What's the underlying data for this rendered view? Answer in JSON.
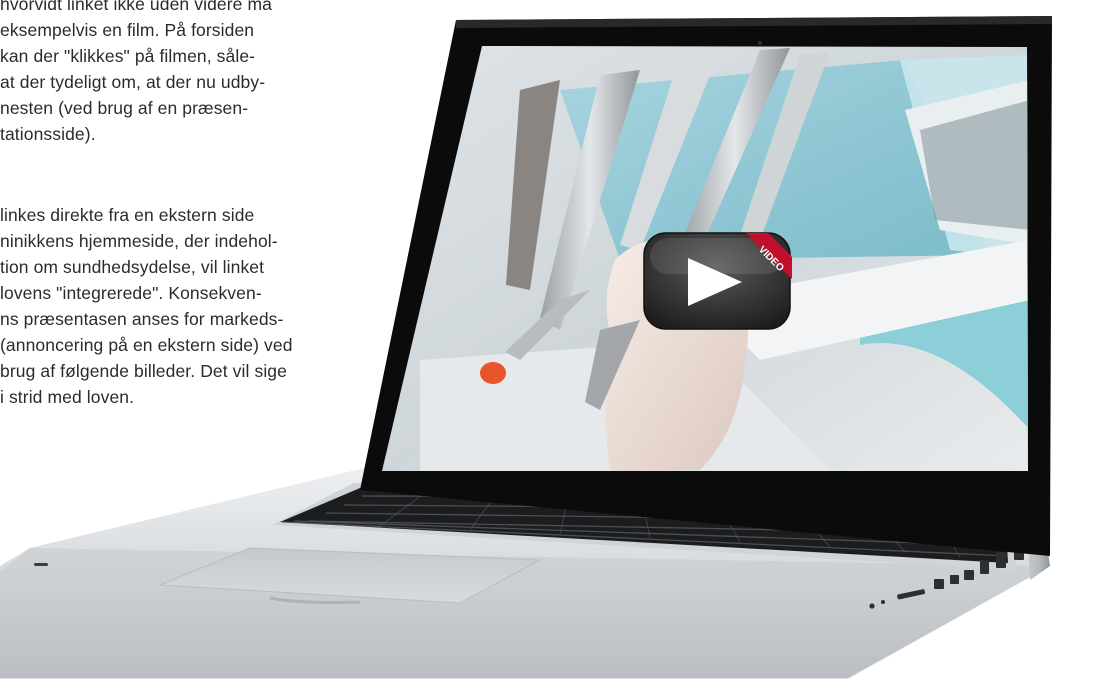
{
  "article": {
    "paragraph1": [
      "hvorvidt linket ikke uden videre må",
      "eksempelvis en film. På forsiden",
      "kan der \"klikkes\" på filmen, såle-",
      "at der tydeligt om, at der nu udby-",
      "nesten (ved brug af en præsen-",
      "tationsside)."
    ],
    "paragraph2": [
      "linkes direkte fra en ekstern side",
      "ninikkens hjemmeside, der indehol-",
      "tion om sundhedsydelse, vil  linket",
      "lovens \"integrerede\". Konsekven-",
      "ns præsentasen anses for markeds-",
      "(annoncering på en ekstern side) ved",
      "brug af følgende billeder. Det vil sige",
      "i strid med loven."
    ]
  },
  "video": {
    "ribbon_label": "VIDEO",
    "play_icon": "play-icon"
  },
  "colors": {
    "play_button": "#3a3a3a",
    "ribbon": "#c8102e",
    "laptop_body": "#d9dcdf",
    "screen_bezel": "#0b0b0b"
  }
}
